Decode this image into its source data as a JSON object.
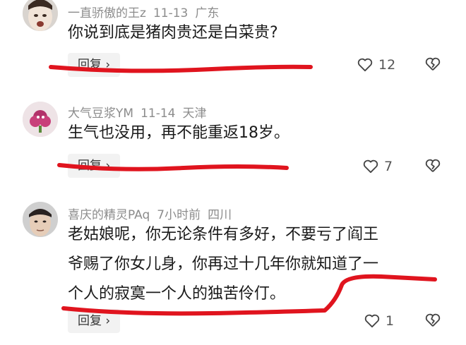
{
  "comments": [
    {
      "username": "一直骄傲的王z",
      "date": "11-13",
      "location": "广东",
      "text_lines": [
        "你说到底是猪肉贵还是白菜贵?"
      ],
      "reply_label": "回复 ›",
      "likes": "12"
    },
    {
      "username": "大气豆浆YM",
      "date": "11-14",
      "location": "天津",
      "text_lines": [
        "生气也没用，再不能重返18岁。"
      ],
      "reply_label": "回复 ›",
      "likes": "7"
    },
    {
      "username": "喜庆的精灵PAq",
      "date": "7小时前",
      "location": "四川",
      "text_lines": [
        "老姑娘呢，你无论条件有多好，不要亏了阎王",
        "爷赐了你女儿身，你再过十几年你就知道了一",
        "个人的寂寞一个人的独苦伶仃。"
      ],
      "reply_label": "回复 ›",
      "likes": "1"
    }
  ],
  "annotation_color": "#e0141e",
  "icons": {
    "like": "heart-icon",
    "dislike": "broken-heart-icon"
  }
}
